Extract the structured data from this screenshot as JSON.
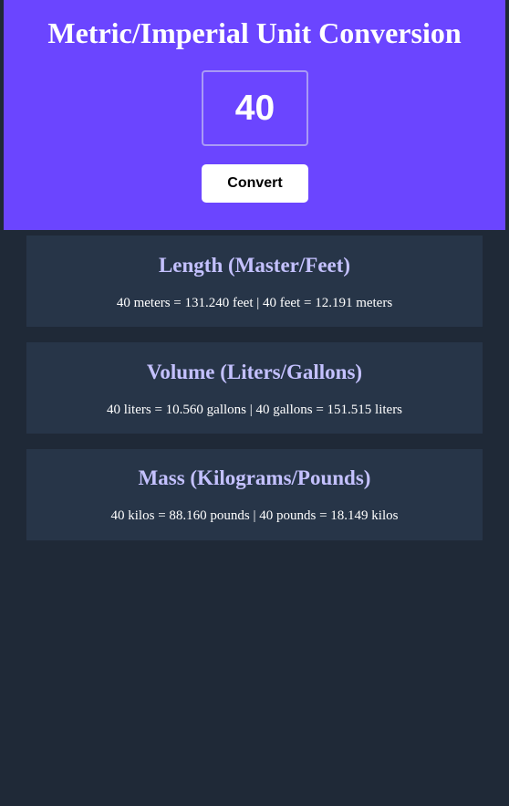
{
  "header": {
    "title": "Metric/Imperial Unit Conversion",
    "input_value": "40",
    "convert_label": "Convert"
  },
  "cards": [
    {
      "title": "Length (Master/Feet)",
      "result": "40 meters = 131.240 feet | 40 feet = 12.191 meters"
    },
    {
      "title": "Volume (Liters/Gallons)",
      "result": "40 liters = 10.560 gallons | 40 gallons = 151.515 liters"
    },
    {
      "title": "Mass (Kilograms/Pounds)",
      "result": "40 kilos = 88.160 pounds | 40 pounds = 18.149 kilos"
    }
  ],
  "colors": {
    "header_bg": "#6b45ff",
    "page_bg": "#1f2937",
    "card_bg": "#273548",
    "card_title": "#c4c1ff"
  }
}
